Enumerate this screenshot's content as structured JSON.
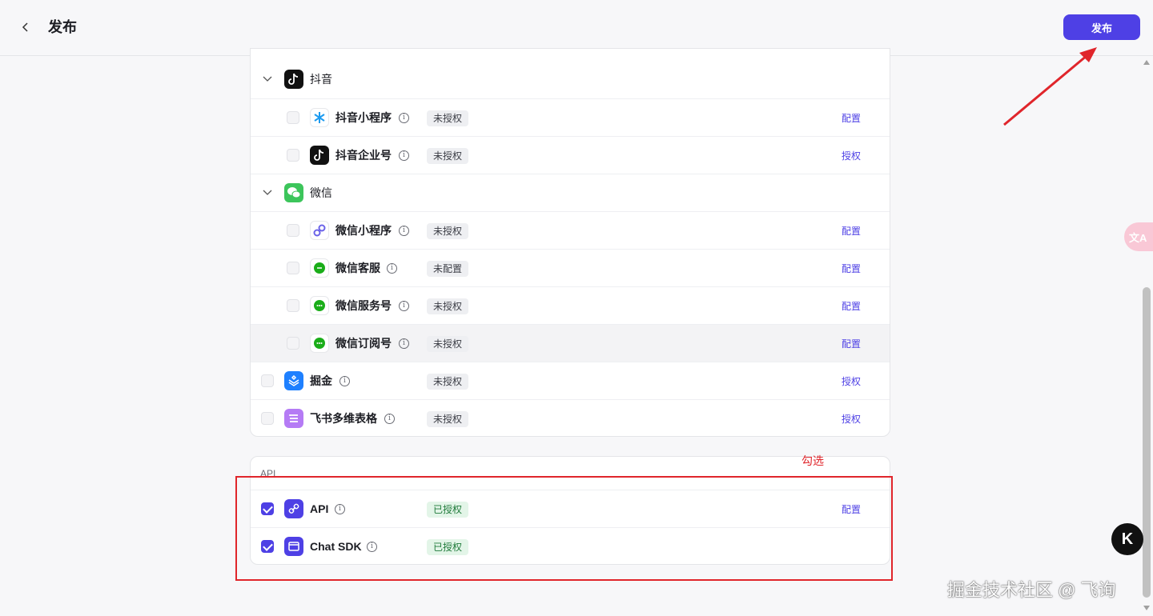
{
  "header": {
    "title": "发布",
    "publish_label": "发布"
  },
  "groups": {
    "douyin": {
      "label": "抖音",
      "items": [
        {
          "label": "抖音小程序",
          "status": "未授权",
          "action": "配置"
        },
        {
          "label": "抖音企业号",
          "status": "未授权",
          "action": "授权"
        }
      ]
    },
    "wechat": {
      "label": "微信",
      "items": [
        {
          "label": "微信小程序",
          "status": "未授权",
          "action": "配置"
        },
        {
          "label": "微信客服",
          "status": "未配置",
          "action": "配置"
        },
        {
          "label": "微信服务号",
          "status": "未授权",
          "action": "配置"
        },
        {
          "label": "微信订阅号",
          "status": "未授权",
          "action": "配置"
        }
      ]
    }
  },
  "standalone": [
    {
      "label": "掘金",
      "status": "未授权",
      "action": "授权"
    },
    {
      "label": "飞书多维表格",
      "status": "未授权",
      "action": "授权"
    }
  ],
  "api_section": {
    "title": "API",
    "items": [
      {
        "label": "API",
        "status": "已授权",
        "action": "配置",
        "checked": true
      },
      {
        "label": "Chat SDK",
        "status": "已授权",
        "action": "",
        "checked": true
      }
    ]
  },
  "annotation": {
    "text": "勾选"
  },
  "floating": {
    "translate_label": "文A",
    "k_label": "K"
  },
  "watermark": "掘金技术社区 @ 飞询",
  "colors": {
    "primary": "#4e40e5",
    "annotation_red": "#e0252b",
    "authorized_bg": "#e3f5e8",
    "tag_bg": "#eeeff2"
  }
}
